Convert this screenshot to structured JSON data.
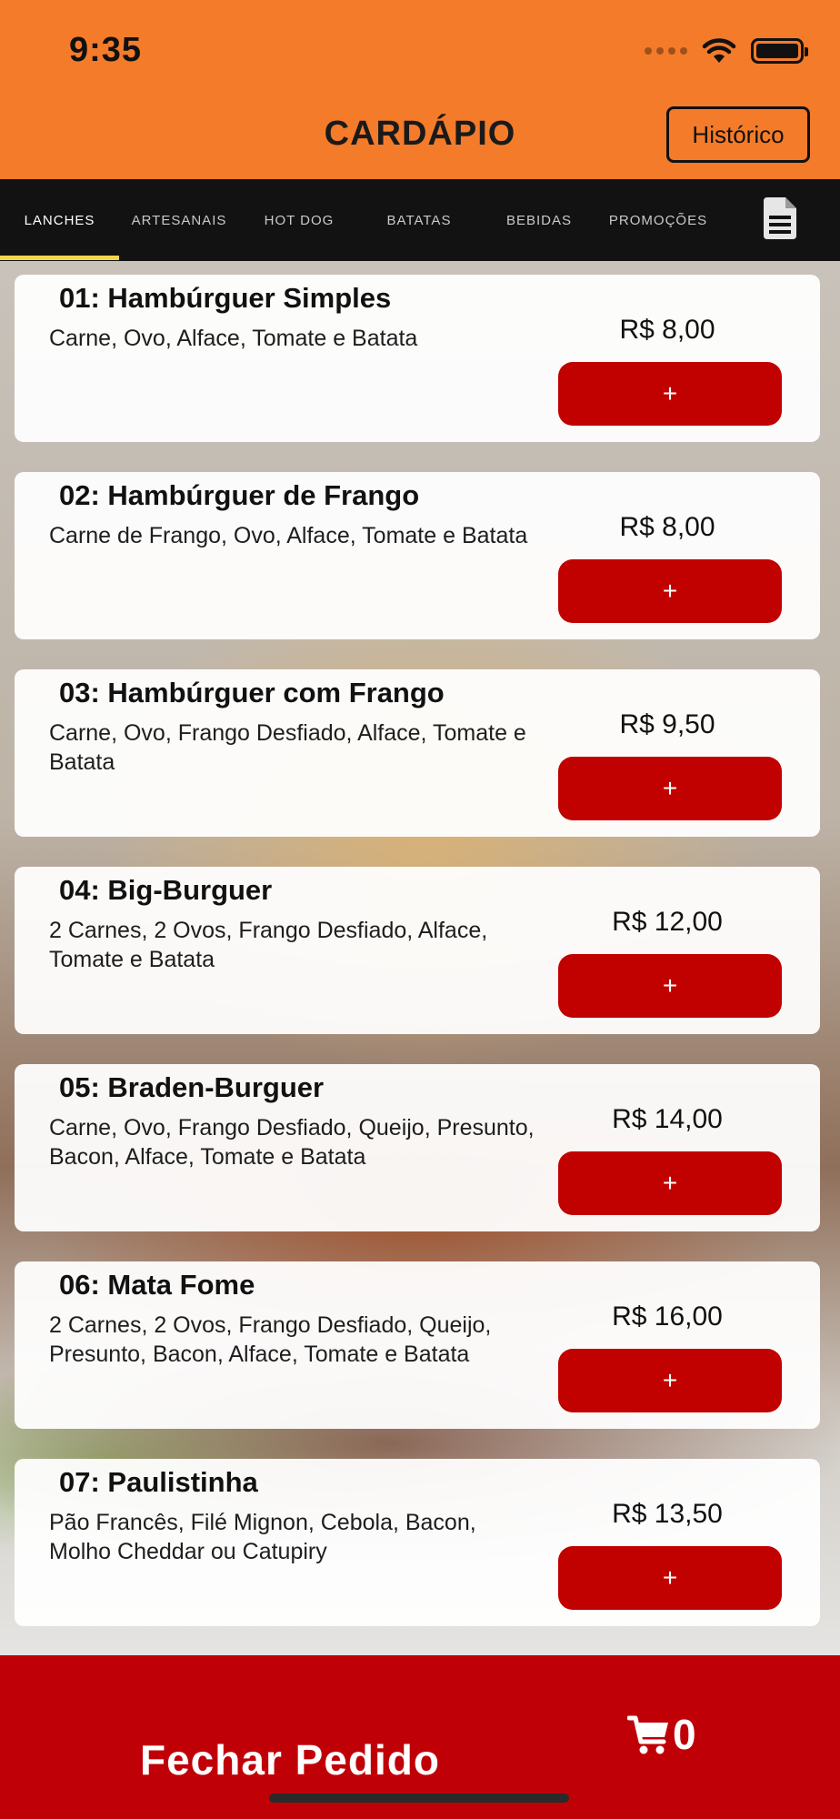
{
  "status": {
    "time": "9:35"
  },
  "header": {
    "title": "CARDÁPIO",
    "history_label": "Histórico"
  },
  "tabs": [
    {
      "label": "LANCHES",
      "active": true
    },
    {
      "label": "ARTESANAIS",
      "active": false
    },
    {
      "label": "HOT DOG",
      "active": false
    },
    {
      "label": "BATATAS",
      "active": false
    },
    {
      "label": "BEBIDAS",
      "active": false
    },
    {
      "label": "PROMOÇÕES",
      "active": false
    }
  ],
  "tab_bar_icon": "document-icon",
  "menu": {
    "items": [
      {
        "title": "01: Hambúrguer Simples",
        "description": "Carne, Ovo, Alface, Tomate e Batata",
        "price": "R$ 8,00",
        "add_label": "+"
      },
      {
        "title": "02: Hambúrguer de Frango",
        "description": "Carne de Frango, Ovo, Alface, Tomate e Batata",
        "price": "R$ 8,00",
        "add_label": "+"
      },
      {
        "title": "03: Hambúrguer com Frango",
        "description": "Carne, Ovo, Frango Desfiado, Alface, Tomate e Batata",
        "price": "R$ 9,50",
        "add_label": "+"
      },
      {
        "title": "04: Big-Burguer",
        "description": "2 Carnes, 2 Ovos, Frango Desfiado, Alface, Tomate e Batata",
        "price": "R$ 12,00",
        "add_label": "+"
      },
      {
        "title": "05: Braden-Burguer",
        "description": "Carne, Ovo, Frango Desfiado, Queijo, Presunto, Bacon, Alface, Tomate e Batata",
        "price": "R$ 14,00",
        "add_label": "+"
      },
      {
        "title": "06: Mata Fome",
        "description": "2 Carnes, 2 Ovos, Frango Desfiado, Queijo, Presunto, Bacon, Alface, Tomate e Batata",
        "price": "R$ 16,00",
        "add_label": "+"
      },
      {
        "title": "07: Paulistinha",
        "description": "Pão Francês, Filé Mignon, Cebola, Bacon, Molho Cheddar ou Catupiry",
        "price": "R$ 13,50",
        "add_label": "+"
      }
    ]
  },
  "footer": {
    "checkout_label": "Fechar Pedido",
    "cart_icon": "cart-icon",
    "cart_count": "0"
  },
  "colors": {
    "header_bg": "#f47b2a",
    "tab_bg": "#121212",
    "tab_indicator": "#f2d44a",
    "button_red": "#c10000",
    "footer_red": "#c00007"
  }
}
